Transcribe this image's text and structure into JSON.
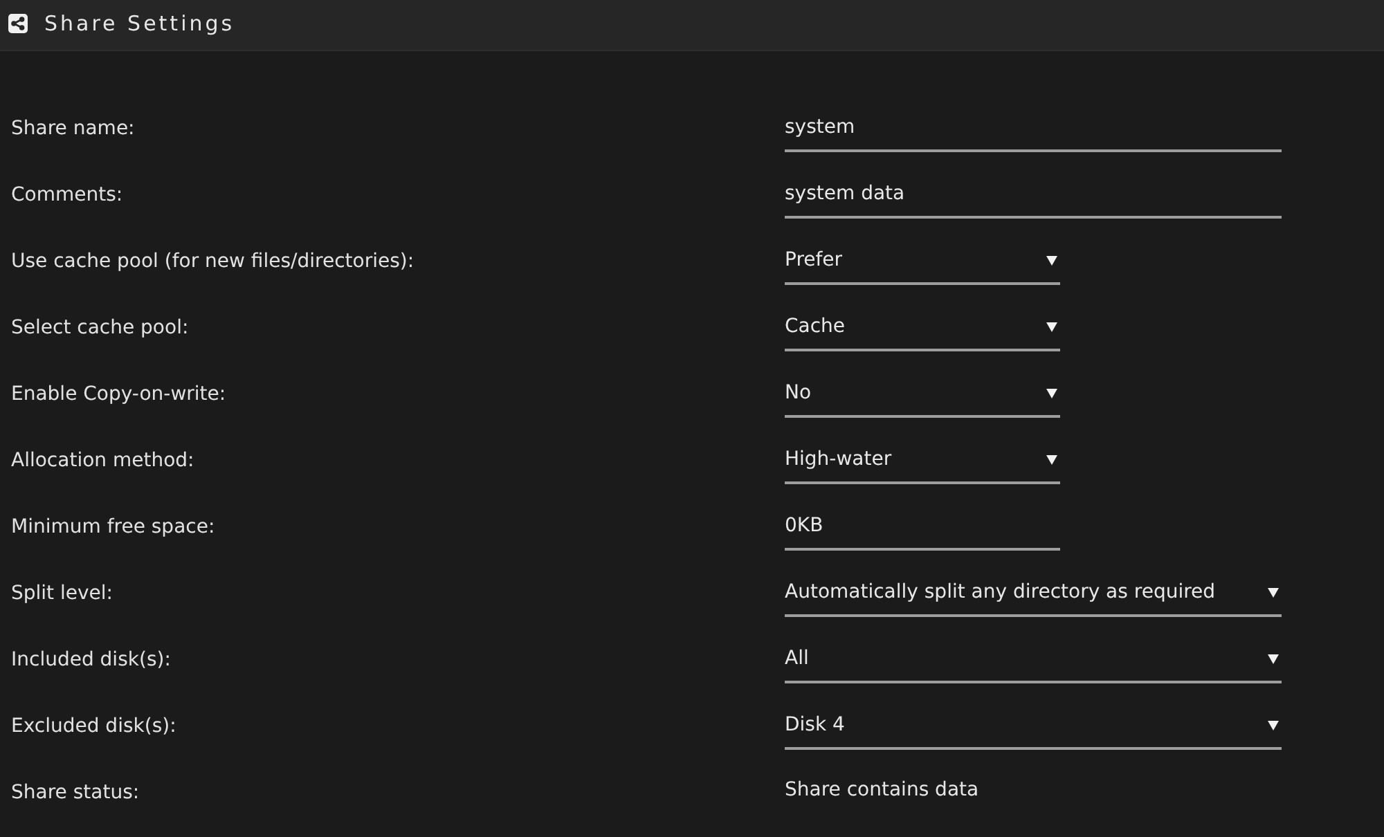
{
  "header": {
    "title": "Share Settings"
  },
  "settings": [
    {
      "label": "Share name:",
      "kind": "wide-input",
      "value": "system"
    },
    {
      "label": "Comments:",
      "kind": "wide-input",
      "value": "system data"
    },
    {
      "label": "Use cache pool (for new files/directories):",
      "kind": "short-select",
      "value": "Prefer"
    },
    {
      "label": "Select cache pool:",
      "kind": "short-select",
      "value": "Cache"
    },
    {
      "label": "Enable Copy-on-write:",
      "kind": "short-select",
      "value": "No"
    },
    {
      "label": "Allocation method:",
      "kind": "short-select",
      "value": "High-water"
    },
    {
      "label": "Minimum free space:",
      "kind": "short-input",
      "value": "0KB"
    },
    {
      "label": "Split level:",
      "kind": "wide-select",
      "value": "Automatically split any directory as required"
    },
    {
      "label": "Included disk(s):",
      "kind": "wide-select",
      "value": "All"
    },
    {
      "label": "Excluded disk(s):",
      "kind": "wide-select",
      "value": "Disk 4"
    },
    {
      "label": "Share status:",
      "kind": "status",
      "value": "Share contains data"
    }
  ]
}
